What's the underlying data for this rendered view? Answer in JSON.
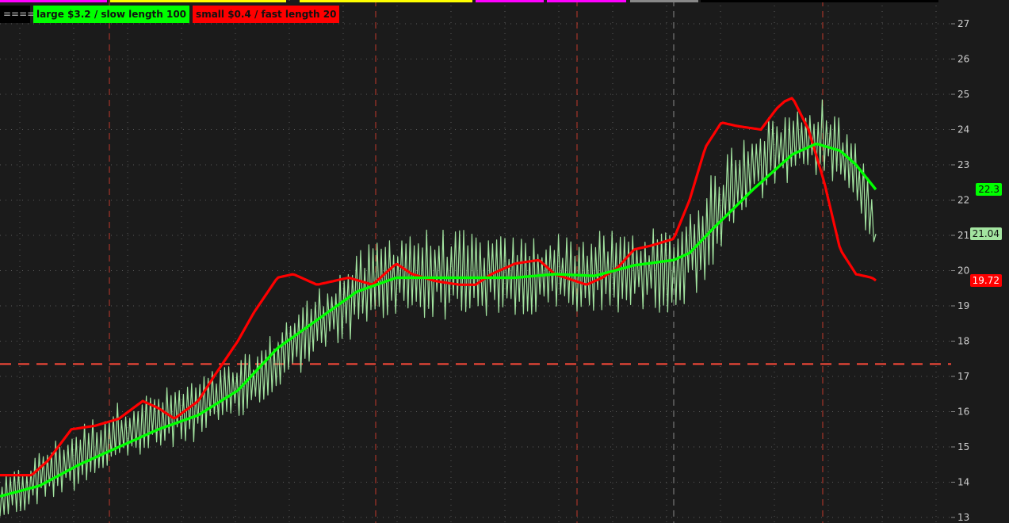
{
  "legend": {
    "marker": "====",
    "large_label": "large $3.2 / slow length 100",
    "small_label": "small $0.4 / fast length 20"
  },
  "colors": {
    "background": "#1b1b1b",
    "price": "#a3e4a0",
    "slow": "#00ff00",
    "fast": "#ff0000",
    "grid": "#5a5a5a",
    "vline_red": "#c0392b",
    "vline_gray": "#8a8a8a",
    "hline": "#ff4a3a",
    "axis_text": "#cfcfcf"
  },
  "price_badges": {
    "slow_value": "22.3",
    "price_value": "21.04",
    "fast_value": "19.72"
  },
  "chart_data": {
    "type": "line",
    "ylim": [
      13,
      27
    ],
    "y_ticks": [
      "13",
      "14",
      "15",
      "16",
      "17",
      "18",
      "19",
      "20",
      "21",
      "22",
      "23",
      "24",
      "25",
      "26",
      "27"
    ],
    "horizontal_level": 17.35,
    "x_range": [
      0,
      1105
    ],
    "vertical_markers": [
      {
        "x": 138,
        "color": "red"
      },
      {
        "x": 474,
        "color": "red"
      },
      {
        "x": 728,
        "color": "red"
      },
      {
        "x": 850,
        "color": "gray"
      },
      {
        "x": 1038,
        "color": "red"
      }
    ],
    "series": [
      {
        "name": "large $3.2 / slow length 100",
        "role": "slow",
        "x": [
          0,
          50,
          100,
          150,
          200,
          250,
          300,
          350,
          400,
          450,
          500,
          550,
          600,
          650,
          700,
          750,
          800,
          850,
          870,
          900,
          950,
          1000,
          1030,
          1060,
          1080,
          1105
        ],
        "values": [
          13.6,
          13.9,
          14.5,
          15.0,
          15.5,
          15.9,
          16.6,
          17.8,
          18.6,
          19.4,
          19.8,
          19.8,
          19.8,
          19.8,
          19.9,
          19.85,
          20.15,
          20.3,
          20.5,
          21.2,
          22.3,
          23.3,
          23.6,
          23.4,
          23.0,
          22.3
        ]
      },
      {
        "name": "small $0.4 / fast length 20",
        "role": "fast",
        "x": [
          0,
          40,
          60,
          90,
          120,
          150,
          180,
          200,
          220,
          250,
          270,
          300,
          320,
          350,
          370,
          400,
          420,
          440,
          470,
          500,
          520,
          550,
          580,
          600,
          620,
          650,
          680,
          700,
          740,
          760,
          780,
          800,
          820,
          850,
          870,
          890,
          910,
          930,
          960,
          980,
          990,
          1000,
          1020,
          1040,
          1060,
          1080,
          1100,
          1105
        ],
        "values": [
          14.2,
          14.2,
          14.6,
          15.5,
          15.6,
          15.8,
          16.3,
          16.1,
          15.8,
          16.3,
          17.0,
          18.0,
          18.8,
          19.8,
          19.9,
          19.6,
          19.7,
          19.8,
          19.6,
          20.2,
          19.9,
          19.7,
          19.6,
          19.6,
          19.9,
          20.2,
          20.3,
          19.9,
          19.6,
          19.8,
          20.1,
          20.6,
          20.7,
          20.9,
          22.0,
          23.5,
          24.2,
          24.1,
          24.0,
          24.6,
          24.8,
          24.9,
          24.0,
          22.5,
          20.6,
          19.9,
          19.8,
          19.72
        ]
      },
      {
        "name": "price",
        "role": "price",
        "x": [
          0,
          30,
          60,
          90,
          120,
          150,
          180,
          210,
          240,
          270,
          300,
          330,
          360,
          390,
          420,
          450,
          480,
          510,
          540,
          570,
          600,
          630,
          660,
          690,
          720,
          750,
          780,
          810,
          840,
          860,
          880,
          900,
          920,
          940,
          960,
          980,
          1000,
          1020,
          1040,
          1060,
          1080,
          1105
        ],
        "values": [
          13.5,
          13.8,
          14.3,
          14.6,
          15.0,
          15.4,
          15.6,
          15.8,
          16.0,
          16.3,
          16.6,
          17.0,
          17.7,
          18.3,
          18.8,
          19.3,
          19.7,
          20.0,
          19.9,
          19.9,
          19.9,
          19.8,
          19.8,
          19.9,
          19.9,
          19.9,
          20.0,
          20.0,
          20.0,
          20.2,
          20.8,
          21.4,
          22.2,
          22.8,
          23.1,
          23.4,
          23.5,
          23.7,
          23.8,
          23.3,
          22.8,
          21.04
        ],
        "amplitude": [
          0.6,
          0.7,
          0.8,
          0.9,
          0.9,
          0.9,
          0.9,
          0.9,
          0.9,
          0.9,
          0.9,
          0.9,
          1.0,
          1.0,
          1.1,
          1.2,
          1.3,
          1.3,
          1.3,
          1.3,
          1.2,
          1.2,
          1.2,
          1.2,
          1.2,
          1.2,
          1.2,
          1.2,
          1.2,
          1.3,
          1.4,
          1.4,
          1.3,
          1.3,
          1.2,
          1.1,
          1.1,
          1.1,
          1.1,
          1.0,
          1.0,
          0.9
        ]
      }
    ]
  }
}
